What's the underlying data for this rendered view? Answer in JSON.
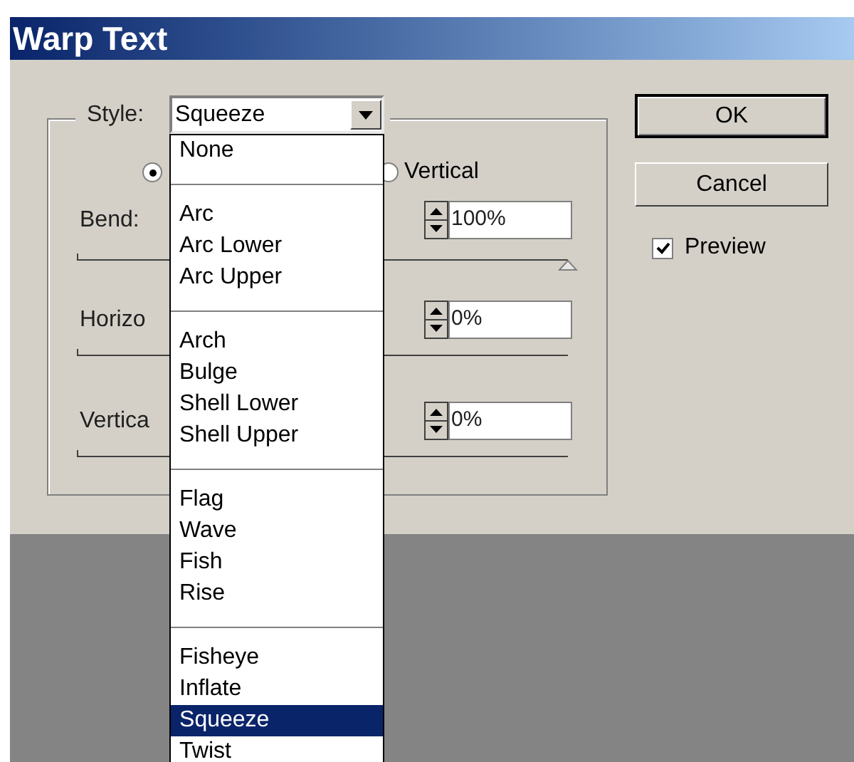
{
  "window": {
    "title": "Warp Text"
  },
  "style": {
    "label": "Style:",
    "value": "Squeeze",
    "expanded": true,
    "menu_groups": [
      [
        {
          "label": "None",
          "selected": false
        }
      ],
      [
        {
          "label": "Arc",
          "selected": false
        },
        {
          "label": "Arc Lower",
          "selected": false
        },
        {
          "label": "Arc Upper",
          "selected": false
        }
      ],
      [
        {
          "label": "Arch",
          "selected": false
        },
        {
          "label": "Bulge",
          "selected": false
        },
        {
          "label": "Shell Lower",
          "selected": false
        },
        {
          "label": "Shell Upper",
          "selected": false
        }
      ],
      [
        {
          "label": "Flag",
          "selected": false
        },
        {
          "label": "Wave",
          "selected": false
        },
        {
          "label": "Fish",
          "selected": false
        },
        {
          "label": "Rise",
          "selected": false
        }
      ],
      [
        {
          "label": "Fisheye",
          "selected": false
        },
        {
          "label": "Inflate",
          "selected": false
        },
        {
          "label": "Squeeze",
          "selected": true
        },
        {
          "label": "Twist",
          "selected": false
        }
      ]
    ]
  },
  "orientation": [
    {
      "selected": true
    },
    {
      "label": "Vertical",
      "selected": false
    }
  ],
  "sliders": [
    {
      "label": "Bend:",
      "value": "100%",
      "level": 1
    },
    {
      "label": "Horizo",
      "value": "0%"
    },
    {
      "label": "Vertica",
      "value": "0%"
    }
  ],
  "buttons": [
    {
      "label": "OK",
      "default": true
    },
    {
      "label": "Cancel",
      "default": false
    }
  ],
  "preview": {
    "label": "Preview",
    "checked": true
  }
}
